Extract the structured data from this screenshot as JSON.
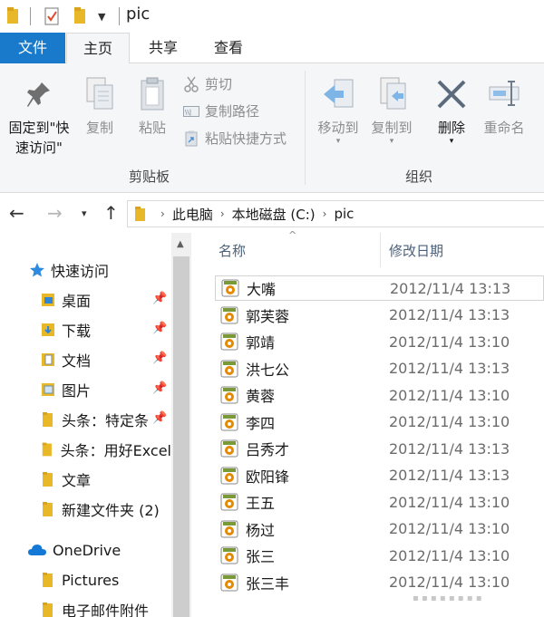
{
  "window": {
    "title": "pic"
  },
  "tabs": {
    "file": "文件",
    "home": "主页",
    "share": "共享",
    "view": "查看"
  },
  "ribbon": {
    "pin_label_line1": "固定到\"快",
    "pin_label_line2": "速访问\"",
    "copy": "复制",
    "paste": "粘贴",
    "cut": "剪切",
    "copy_path": "复制路径",
    "paste_shortcut": "粘贴快捷方式",
    "clipboard_group": "剪贴板",
    "move_to": "移动到",
    "copy_to": "复制到",
    "delete": "删除",
    "rename": "重命名",
    "organize_group": "组织"
  },
  "address": {
    "crumbs": [
      "此电脑",
      "本地磁盘 (C:)",
      "pic"
    ]
  },
  "nav": {
    "quick_access": "快速访问",
    "items": [
      {
        "label": "桌面",
        "pinned": true
      },
      {
        "label": "下载",
        "pinned": true
      },
      {
        "label": "文档",
        "pinned": true
      },
      {
        "label": "图片",
        "pinned": true
      },
      {
        "label": "头条：特定条",
        "pinned": true
      },
      {
        "label": "头条：用好Excel",
        "pinned": false
      },
      {
        "label": "文章",
        "pinned": false
      },
      {
        "label": "新建文件夹 (2)",
        "pinned": false
      }
    ],
    "onedrive": "OneDrive",
    "onedrive_items": [
      "Pictures",
      "电子邮件附件"
    ]
  },
  "columns": {
    "name": "名称",
    "date": "修改日期"
  },
  "files": [
    {
      "name": "大嘴",
      "date": "2012/11/4 13:13"
    },
    {
      "name": "郭芙蓉",
      "date": "2012/11/4 13:13"
    },
    {
      "name": "郭靖",
      "date": "2012/11/4 13:10"
    },
    {
      "name": "洪七公",
      "date": "2012/11/4 13:13"
    },
    {
      "name": "黄蓉",
      "date": "2012/11/4 13:10"
    },
    {
      "name": "李四",
      "date": "2012/11/4 13:10"
    },
    {
      "name": "吕秀才",
      "date": "2012/11/4 13:13"
    },
    {
      "name": "欧阳锋",
      "date": "2012/11/4 13:13"
    },
    {
      "name": "王五",
      "date": "2012/11/4 13:10"
    },
    {
      "name": "杨过",
      "date": "2012/11/4 13:10"
    },
    {
      "name": "张三",
      "date": "2012/11/4 13:10"
    },
    {
      "name": "张三丰",
      "date": "2012/11/4 13:10"
    }
  ],
  "colors": {
    "accent": "#1979ca",
    "folder": "#e8b829",
    "file_icon": "#e58a00"
  }
}
